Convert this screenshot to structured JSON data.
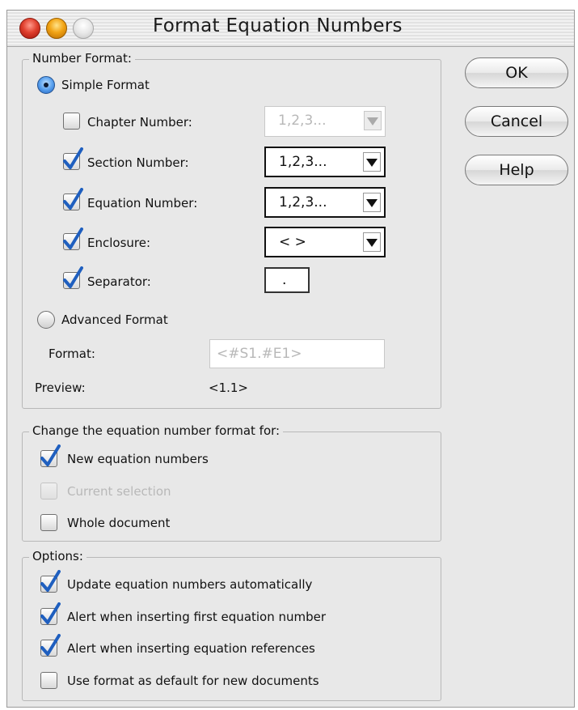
{
  "window": {
    "title": "Format Equation Numbers"
  },
  "number_format": {
    "legend": "Number Format:",
    "simple_format": "Simple Format",
    "chapter": {
      "label": "Chapter Number:",
      "checked": false,
      "value": "1,2,3..."
    },
    "section": {
      "label": "Section Number:",
      "checked": true,
      "value": "1,2,3..."
    },
    "equation": {
      "label": "Equation Number:",
      "checked": true,
      "value": "1,2,3..."
    },
    "enclosure": {
      "label": "Enclosure:",
      "checked": true,
      "value": "< >"
    },
    "separator": {
      "label": "Separator:",
      "checked": true,
      "value": "."
    },
    "advanced_format": "Advanced Format",
    "format_label": "Format:",
    "format_value": "<#S1.#E1>",
    "preview_label": "Preview:",
    "preview_value": "<1.1>"
  },
  "change_for": {
    "legend": "Change the equation number format for:",
    "new_numbers": "New equation numbers",
    "current_selection": "Current selection",
    "whole_document": "Whole document"
  },
  "options": {
    "legend": "Options:",
    "update_auto": "Update equation numbers automatically",
    "alert_first": "Alert when inserting first equation number",
    "alert_refs": "Alert when inserting equation references",
    "use_default": "Use format as default for new documents"
  },
  "buttons": {
    "ok": "OK",
    "cancel": "Cancel",
    "help": "Help"
  },
  "colors": {
    "check_blue": "#1f5fbf",
    "window_bg": "#e8e8e8"
  }
}
